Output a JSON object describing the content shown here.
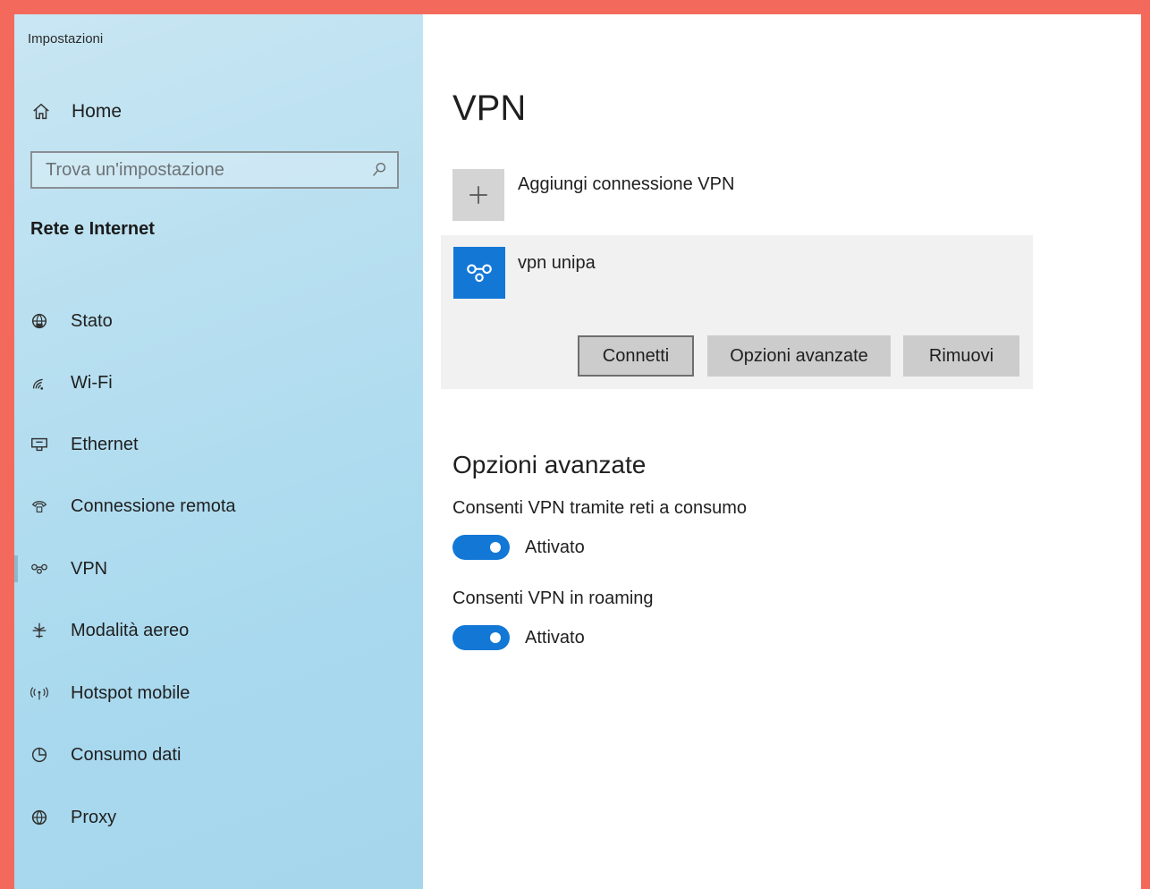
{
  "app_title": "Impostazioni",
  "home_label": "Home",
  "search": {
    "placeholder": "Trova un'impostazione"
  },
  "section_title": "Rete e Internet",
  "nav": [
    {
      "label": "Stato",
      "icon": "globe-status-icon"
    },
    {
      "label": "Wi-Fi",
      "icon": "wifi-icon"
    },
    {
      "label": "Ethernet",
      "icon": "ethernet-icon"
    },
    {
      "label": "Connessione remota",
      "icon": "dial-up-phone-icon"
    },
    {
      "label": "VPN",
      "icon": "vpn-icon",
      "selected": true
    },
    {
      "label": "Modalità aereo",
      "icon": "airplane-icon"
    },
    {
      "label": "Hotspot mobile",
      "icon": "hotspot-icon"
    },
    {
      "label": "Consumo dati",
      "icon": "data-usage-icon"
    },
    {
      "label": "Proxy",
      "icon": "globe-proxy-icon"
    }
  ],
  "main": {
    "title": "VPN",
    "add_connection_label": "Aggiungi connessione VPN",
    "vpn_entry": {
      "name": "vpn unipa",
      "connect_label": "Connetti",
      "advanced_label": "Opzioni avanzate",
      "remove_label": "Rimuovi"
    },
    "advanced_title": "Opzioni avanzate",
    "options": [
      {
        "label": "Consenti VPN tramite reti a consumo",
        "state": "Attivato",
        "on": true
      },
      {
        "label": "Consenti VPN in roaming",
        "state": "Attivato",
        "on": true
      }
    ]
  },
  "colors": {
    "accent": "#1377d6",
    "sidebar": "#b7dff0",
    "frame": "#f36a5c"
  }
}
